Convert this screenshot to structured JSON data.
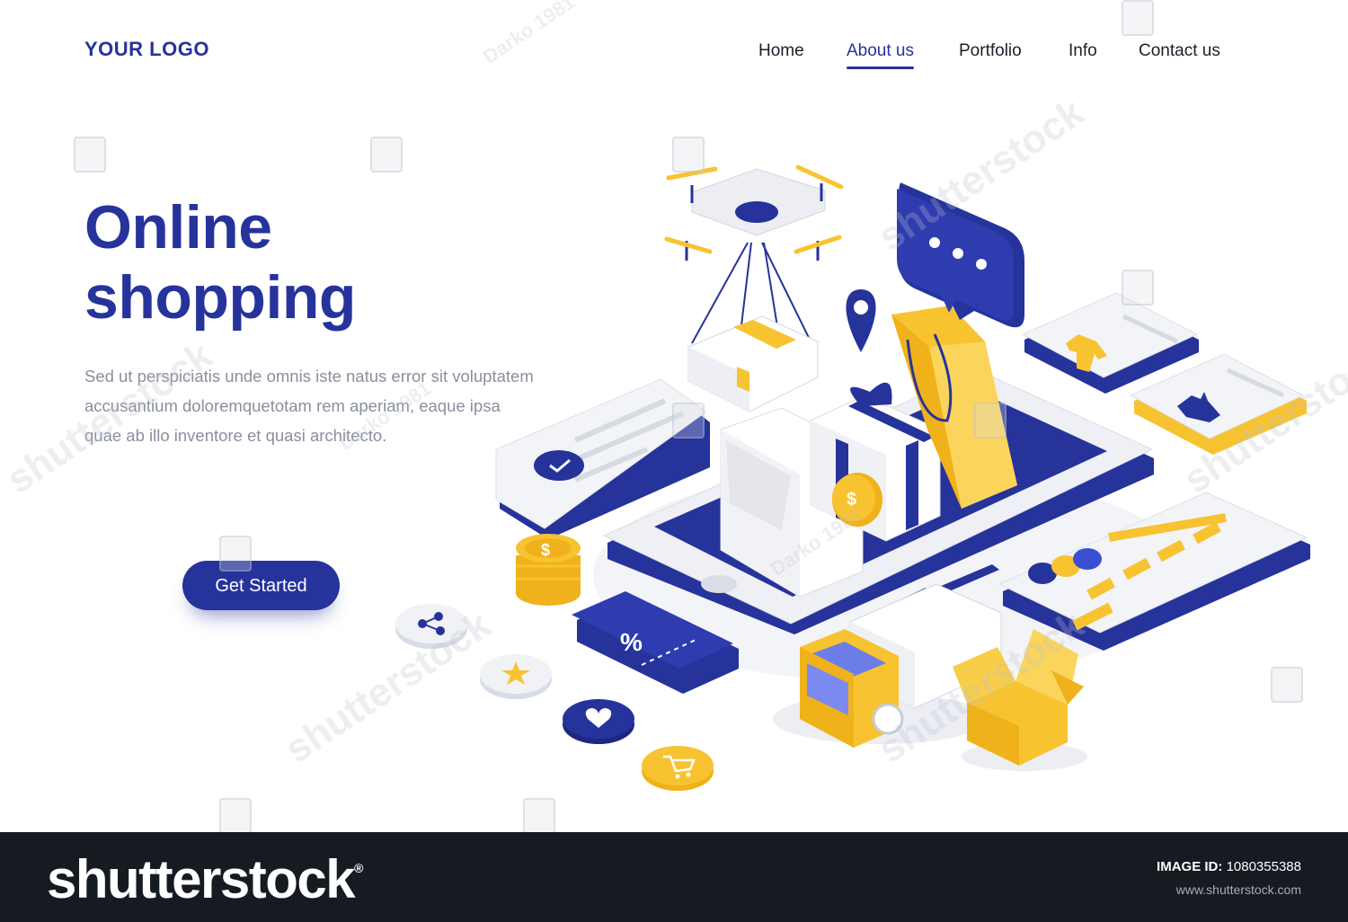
{
  "header": {
    "logo": "YOUR LOGO",
    "nav": [
      {
        "label": "Home"
      },
      {
        "label": "About us",
        "active": true
      },
      {
        "label": "Portfolio"
      },
      {
        "label": "Info"
      },
      {
        "label": "Contact us"
      }
    ]
  },
  "hero": {
    "title_line1": "Online",
    "title_line2": "shopping",
    "description": "Sed ut perspiciatis unde omnis iste natus error sit voluptatem accusantium doloremquetotam rem aperiam, eaque ipsa quae ab illo inventore et quasi architecto.",
    "cta": "Get Started"
  },
  "illustration": {
    "coin_symbol": "$",
    "coupon_symbol": "%",
    "watermark_text": "shutterstock",
    "author_text": "Darko 1981"
  },
  "footer": {
    "brand": "shutterstock",
    "brand_mark": "®",
    "image_id_label": "IMAGE ID:",
    "image_id": "1080355388",
    "url": "www.shutterstock.com"
  },
  "colors": {
    "primary": "#26339b",
    "accent": "#f7c331",
    "light": "#ececef",
    "footer_bg": "#161a21"
  }
}
